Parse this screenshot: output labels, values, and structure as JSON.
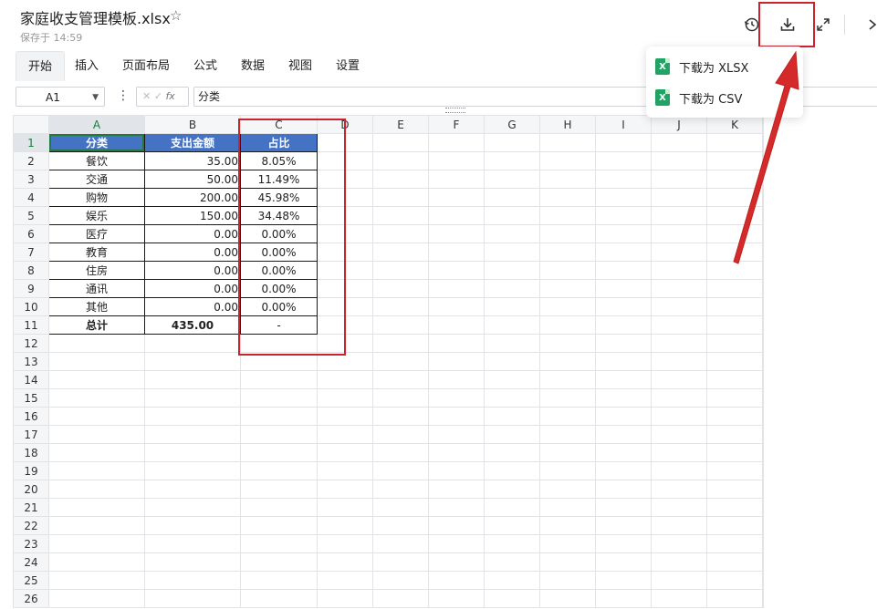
{
  "doc": {
    "title": "家庭收支管理模板.xlsx",
    "saved": "保存于 14:59"
  },
  "menu": [
    "开始",
    "插入",
    "页面布局",
    "公式",
    "数据",
    "视图",
    "设置"
  ],
  "formula_bar": {
    "cell_ref": "A1",
    "formula": "分类",
    "fx_label": "fx"
  },
  "download_menu": {
    "items": [
      "下载为 XLSX",
      "下载为 CSV"
    ]
  },
  "columns": [
    "A",
    "B",
    "C",
    "D",
    "E",
    "F",
    "G",
    "H",
    "I",
    "J",
    "K"
  ],
  "rows": [
    "1",
    "2",
    "3",
    "4",
    "5",
    "6",
    "7",
    "8",
    "9",
    "10",
    "11",
    "12",
    "13",
    "14",
    "15",
    "16",
    "17",
    "18",
    "19",
    "20",
    "21",
    "22",
    "23",
    "24",
    "25",
    "26"
  ],
  "table": {
    "headers": [
      "分类",
      "支出金额",
      "占比"
    ],
    "data": [
      [
        "餐饮",
        "35.00",
        "8.05%"
      ],
      [
        "交通",
        "50.00",
        "11.49%"
      ],
      [
        "购物",
        "200.00",
        "45.98%"
      ],
      [
        "娱乐",
        "150.00",
        "34.48%"
      ],
      [
        "医疗",
        "0.00",
        "0.00%"
      ],
      [
        "教育",
        "0.00",
        "0.00%"
      ],
      [
        "住房",
        "0.00",
        "0.00%"
      ],
      [
        "通讯",
        "0.00",
        "0.00%"
      ],
      [
        "其他",
        "0.00",
        "0.00%"
      ]
    ],
    "total": [
      "总计",
      "435.00",
      "-"
    ]
  },
  "icons": {
    "history": "history-icon",
    "download": "download-icon",
    "expand": "expand-icon",
    "close": "close-icon",
    "star": "star-icon"
  },
  "colors": {
    "header_fill": "#4472c4",
    "accent_green": "#1e7a3d",
    "annotation_red": "#c9232e"
  }
}
